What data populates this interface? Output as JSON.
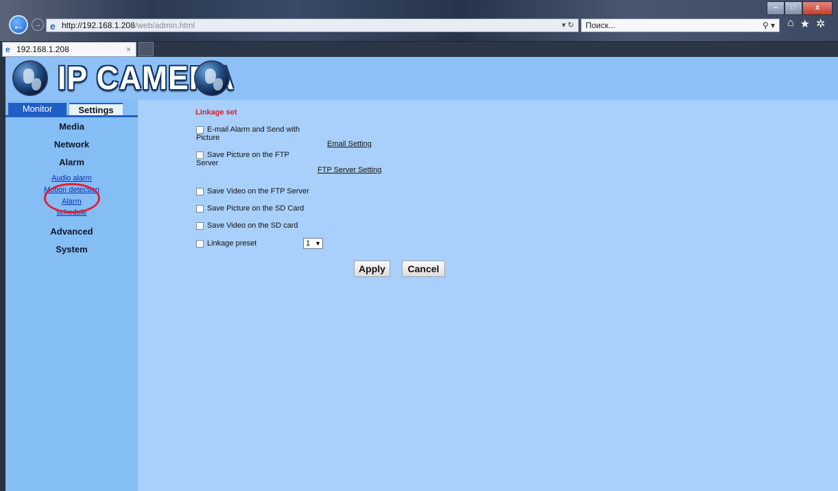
{
  "browser": {
    "window_controls": {
      "minimize": "–",
      "maximize": "□",
      "close": "x"
    },
    "address": {
      "host": "http://192.168.1.208",
      "path": "/web/admin.html"
    },
    "refresh_icon": "refresh-icon",
    "search_placeholder": "Поиск...",
    "tab_title": "192.168.1.208",
    "tab_close": "×",
    "toolbar_icons": [
      "home-icon",
      "favorites-star-icon",
      "settings-gear-icon"
    ]
  },
  "header": {
    "logo_text": "IP CAMERA"
  },
  "sidebar": {
    "tabs": {
      "monitor": "Monitor",
      "settings": "Settings"
    },
    "menu": {
      "media": "Media",
      "network": "Network",
      "alarm": "Alarm",
      "audio_alarm": "Audio alarm",
      "motion_detection": "Motion detection",
      "alarm_schedule_line1": "Alarm",
      "alarm_schedule_line2": "schedule",
      "advanced": "Advanced",
      "system": "System"
    }
  },
  "content": {
    "section_title": "Linkage set",
    "options": {
      "email_line1": "E-mail Alarm and Send with",
      "email_line2": "Picture",
      "ftp_pic_line1": "Save Picture on the FTP",
      "ftp_pic_line2": "Server",
      "ftp_video": "Save Video on the FTP Server",
      "sd_picture": "Save Picture on the SD Card",
      "sd_video": "Save Video on the SD card",
      "linkage_preset": "Linkage preset"
    },
    "links": {
      "email_setting": "Email Setting",
      "ftp_setting": "FTP Server Setting"
    },
    "preset_value": "1",
    "buttons": {
      "apply": "Apply",
      "cancel": "Cancel"
    }
  },
  "colors": {
    "page_bg": "#a8d0fa",
    "sidebar_bg": "#85bdf5",
    "accent_blue": "#1f5fc3",
    "title_red": "#d81e2e",
    "highlight_circle": "#e0203a"
  }
}
